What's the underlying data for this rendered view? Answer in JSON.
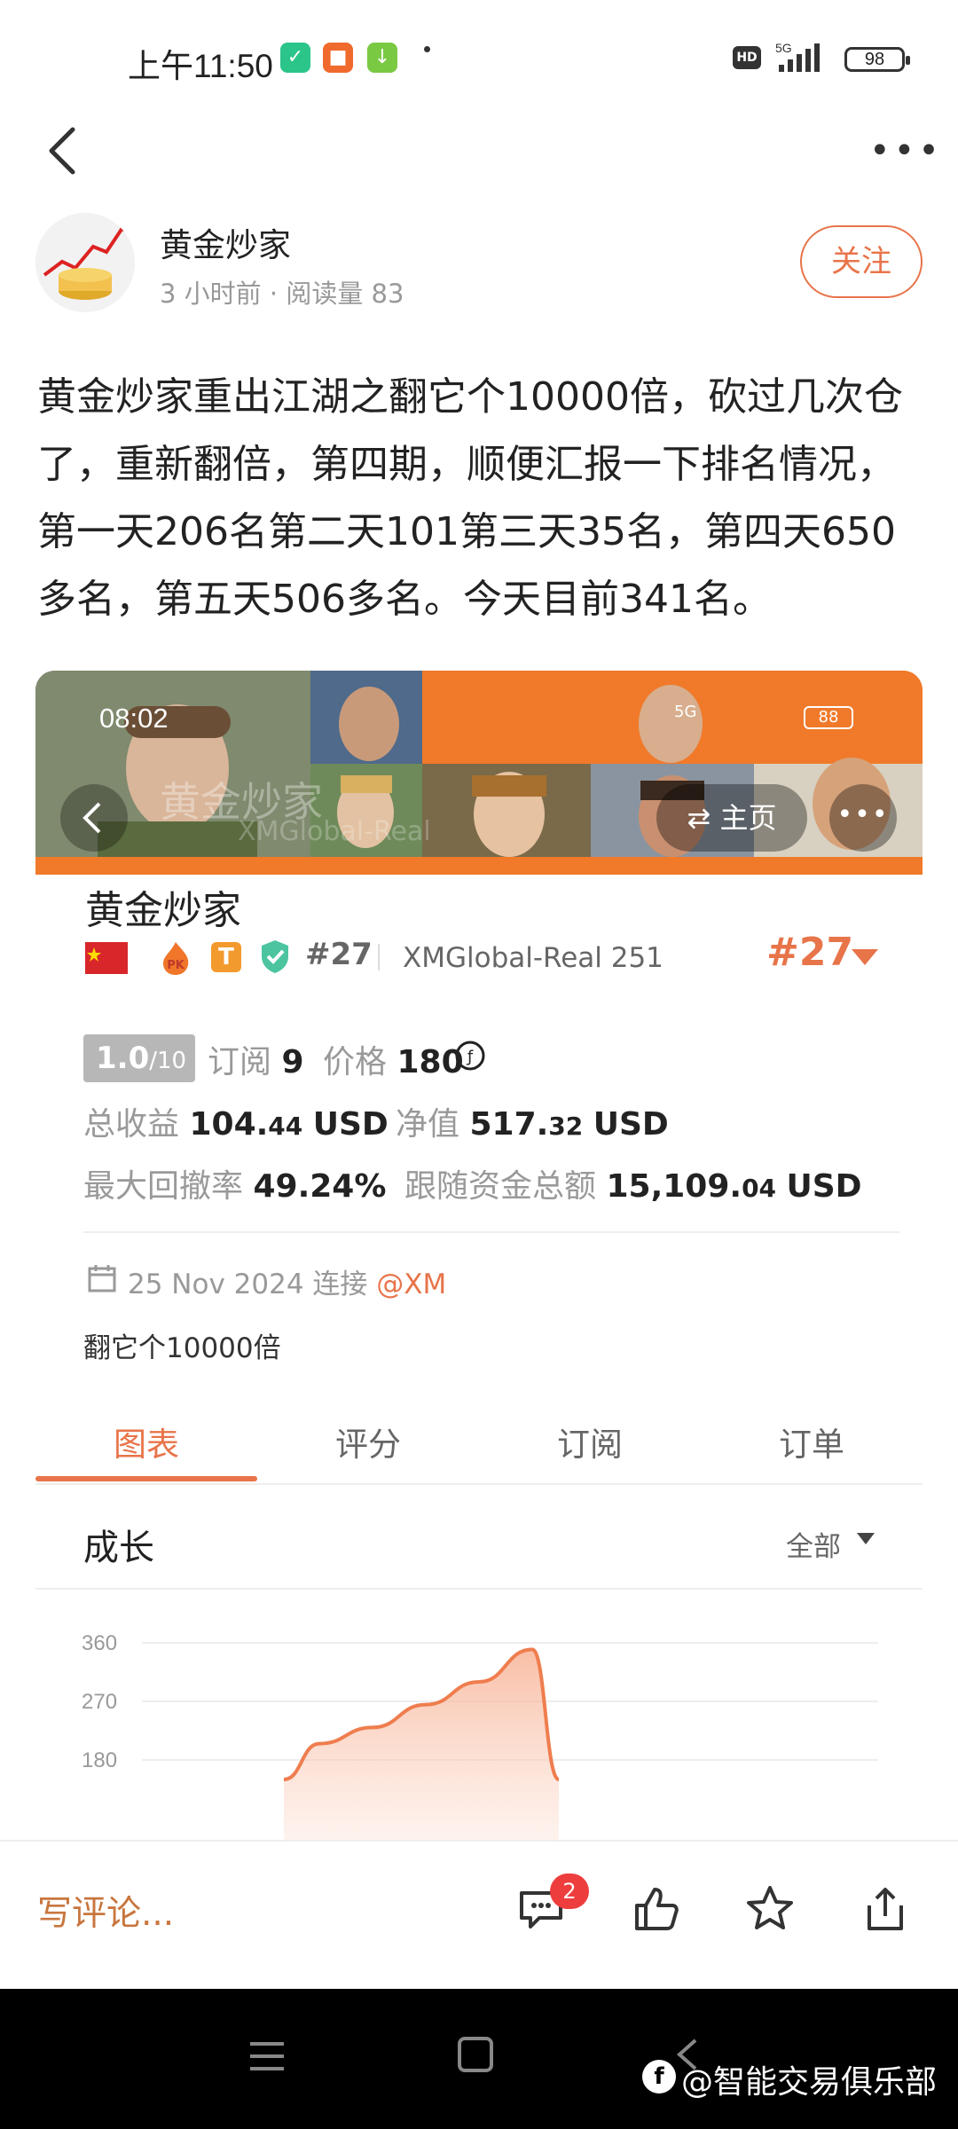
{
  "status_bar": {
    "time": "上午11:50",
    "network": "5G",
    "battery": "98",
    "hd": "HD"
  },
  "post": {
    "author": "黄金炒家",
    "meta": "3 小时前 · 阅读量 83",
    "follow_label": "关注",
    "content": "黄金炒家重出江湖之翻它个10000倍，砍过几次仓了，重新翻倍，第四期，顺便汇报一下排名情况，第一天206名第二天101第三天35名，第四天650多名，第五天506多名。今天目前341名。"
  },
  "embedded_screenshot": {
    "time": "08:02",
    "watermark": "黄金炒家",
    "watermark_sub": "XMGlobal-Real",
    "home_label": "主页",
    "battery": "88",
    "network": "5G"
  },
  "trader": {
    "name": "黄金炒家",
    "badge_pk": "PK",
    "badge_t": "T",
    "rank_small": "#27",
    "account": "XMGlobal-Real 251",
    "rank_big": "#27",
    "score": "1.0",
    "score_max": "/10",
    "subscribe_label": "订阅",
    "subscribe_value": "9",
    "price_label": "价格",
    "price_value": "180",
    "profit_label": "总收益",
    "profit_int": "104.",
    "profit_dec": "44",
    "profit_unit": "USD",
    "equity_label": "净值",
    "equity_int": "517.",
    "equity_dec": "32",
    "equity_unit": "USD",
    "drawdown_label": "最大回撤率",
    "drawdown_value": "49.24%",
    "follow_funds_label": "跟随资金总额",
    "follow_funds_int": "15,109.",
    "follow_funds_dec": "04",
    "follow_funds_unit": "USD",
    "connected_date": "25 Nov 2024 连接",
    "connected_broker": "@XM",
    "description": "翻它个10000倍"
  },
  "tabs": [
    {
      "label": "图表",
      "active": true
    },
    {
      "label": "评分",
      "active": false
    },
    {
      "label": "订阅",
      "active": false
    },
    {
      "label": "订单",
      "active": false
    }
  ],
  "growth": {
    "title": "成长",
    "filter": "全部"
  },
  "chart_data": {
    "type": "area",
    "title": "",
    "yticks": [
      "360",
      "270",
      "180"
    ],
    "x": [
      1,
      2,
      3,
      4,
      5,
      6,
      7
    ],
    "values": [
      150,
      205,
      230,
      265,
      300,
      350,
      150
    ],
    "ylim": [
      160,
      370
    ],
    "color": "#ef7d4e"
  },
  "bottom_bar": {
    "comment_placeholder": "写评论...",
    "comment_count": "2"
  },
  "nav": {
    "watermark": "@智能交易俱乐部"
  },
  "colors": {
    "accent": "#e8744a",
    "brand_orange": "#f07a2a"
  }
}
